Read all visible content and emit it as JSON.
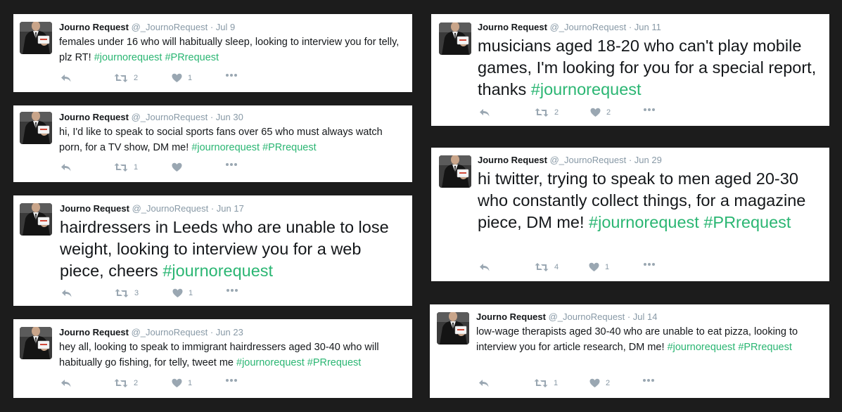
{
  "tweets": [
    {
      "name": "Journo Request",
      "handle": "@_JournoRequest",
      "date": "Jul 9",
      "text": "females under 16 who will habitually sleep, looking to interview you for telly, plz RT!",
      "hashtags": "#journorequest #PRrequest",
      "retweets": "2",
      "likes": "1"
    },
    {
      "name": "Journo Request",
      "handle": "@_JournoRequest",
      "date": "Jun 30",
      "text": "hi, I'd like to speak to social sports fans over 65 who must always watch porn, for a TV show, DM me!",
      "hashtags": "#journorequest #PRrequest",
      "retweets": "1",
      "likes": ""
    },
    {
      "name": "Journo Request",
      "handle": "@_JournoRequest",
      "date": "Jun 17",
      "text": "hairdressers in Leeds who are unable to lose weight, looking to interview you for a web piece, cheers",
      "hashtags": "#journorequest",
      "retweets": "3",
      "likes": "1"
    },
    {
      "name": "Journo Request",
      "handle": "@_JournoRequest",
      "date": "Jun 23",
      "text": "hey all, looking to speak to immigrant hairdressers aged 30-40 who will habitually go fishing, for telly, tweet me",
      "hashtags": "#journorequest #PRrequest",
      "retweets": "2",
      "likes": "1"
    },
    {
      "name": "Journo Request",
      "handle": "@_JournoRequest",
      "date": "Jun 11",
      "text": "musicians aged 18-20 who can't play mobile games, I'm looking for you for a special report, thanks",
      "hashtags": "#journorequest",
      "retweets": "2",
      "likes": "2"
    },
    {
      "name": "Journo Request",
      "handle": "@_JournoRequest",
      "date": "Jun 29",
      "text": "hi twitter, trying to speak to  men aged 20-30 who constantly collect things, for a magazine piece, DM me!",
      "hashtags": "#journorequest #PRrequest",
      "retweets": "4",
      "likes": "1"
    },
    {
      "name": "Journo Request",
      "handle": "@_JournoRequest",
      "date": "Jul 14",
      "text": "low-wage therapists aged 30-40 who are unable to eat pizza, looking to interview you for article research, DM me!",
      "hashtags": "#journorequest #PRrequest",
      "retweets": "1",
      "likes": "2"
    }
  ],
  "colors": {
    "hashtag": "#2bb673",
    "name": "#14171a",
    "meta": "#8899a6",
    "background": "#1c1c1c"
  },
  "icons": [
    "avatar",
    "reply-icon",
    "retweet-icon",
    "like-icon",
    "more-icon"
  ]
}
